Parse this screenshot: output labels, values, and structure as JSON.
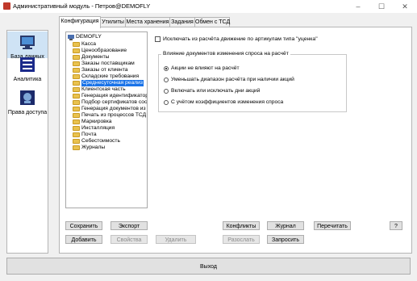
{
  "window": {
    "title": "Административный модуль - Петров@DEMOFLY",
    "controls": [
      "–",
      "☐",
      "✕"
    ]
  },
  "sidebar": {
    "items": [
      {
        "label": "База данных",
        "icon": "database-icon"
      },
      {
        "label": "Аналитика",
        "icon": "analytics-icon"
      },
      {
        "label": "Права доступа",
        "icon": "access-rights-icon"
      }
    ]
  },
  "tabs": [
    "Конфигурация",
    "Утилиты",
    "Места хранения",
    "Задания",
    "Обмен с ТСД"
  ],
  "tree": {
    "root": "DEMOFLY",
    "items": [
      "Касса",
      "Ценообразование",
      "Документы",
      "Заказы поставщикам",
      "Заказы от клиента",
      "Складские требования",
      "Среднесуточная реализ",
      "Клиентская часть",
      "Генерация идентификатор",
      "Подбор сертификатов соо",
      "Генерация документов из",
      "Печать из процессов ТСД",
      "Маркировка",
      "Инсталляция",
      "Почта",
      "Себестоимость",
      "Журналы"
    ],
    "selected": "Среднесуточная реализ"
  },
  "settings": {
    "exclude_label": "Исключать из расчёта движение по артикулам типа \"уценка\"",
    "group_title": "Влияние документов изменения спроса на расчёт",
    "options": [
      "Акции не влияют на расчёт",
      "Уменьшать диапазон расчёта при наличии акций",
      "Включать или исключать дни акций",
      "С учётом коэффициентов изменения спроса"
    ],
    "selected_option": "Акции не влияют на расчёт"
  },
  "buttons": {
    "save": "Сохранить",
    "export": "Экспорт",
    "add": "Добавить",
    "properties": "Свойства",
    "delete": "Удалить",
    "conflicts": "Конфликты",
    "journal": "Журнал",
    "recalc": "Перечитать",
    "help": "?",
    "resolve": "Разослать",
    "request": "Запросить",
    "exit": "Выход"
  }
}
